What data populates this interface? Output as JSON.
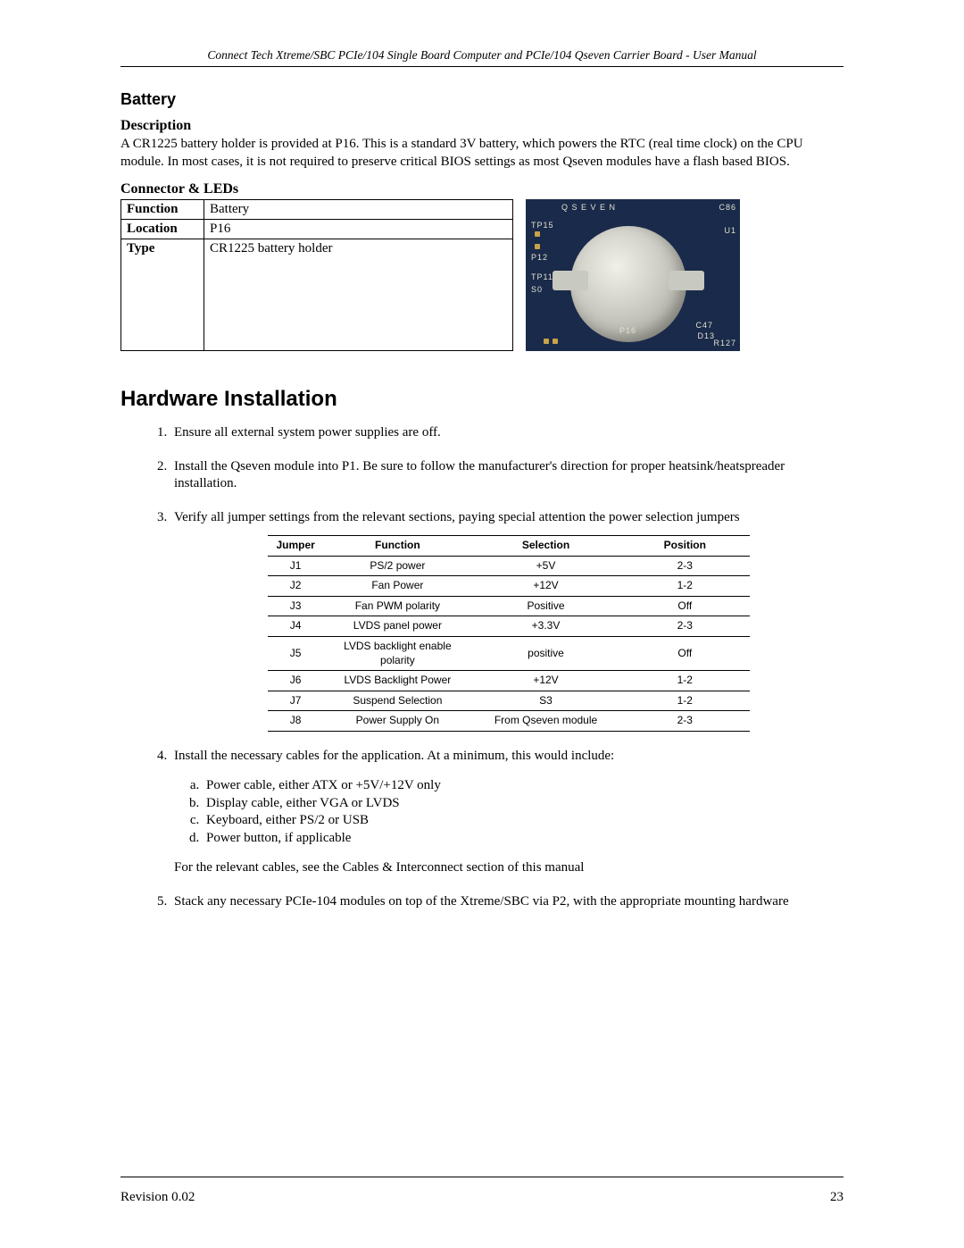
{
  "header": "Connect Tech Xtreme/SBC PCIe/104 Single Board Computer and PCIe/104 Qseven Carrier Board - User Manual",
  "battery": {
    "title": "Battery",
    "desc_heading": "Description",
    "desc_text": "A CR1225 battery holder is provided at P16.  This is a standard 3V battery, which powers the RTC (real time clock) on the CPU module.  In most cases, it is not required to preserve critical BIOS settings as most Qseven modules have a flash based BIOS.",
    "conn_heading": "Connector & LEDs",
    "rows": {
      "function_label": "Function",
      "function_value": "Battery",
      "location_label": "Location",
      "location_value": "P16",
      "type_label": "Type",
      "type_value": "CR1225 battery holder"
    },
    "silk": {
      "brand": "Q S E V E N",
      "ref": "P16",
      "cap": "C47",
      "res": "R127",
      "tp15": "TP15",
      "tp12": "P12",
      "tp11": "TP11",
      "c86": "C86",
      "u1": "U1",
      "d13": "D13",
      "s0": "S0"
    }
  },
  "hw": {
    "title": "Hardware Installation",
    "steps": [
      "Ensure all external system power supplies are off.",
      "Install the Qseven module into P1. Be sure to follow the manufacturer's direction for proper heatsink/heatspreader installation.",
      "Verify all jumper settings from the relevant sections, paying special attention the power selection jumpers",
      "Install the necessary cables for the application.  At a minimum, this would include:",
      "Stack any necessary PCIe-104 modules on top of the Xtreme/SBC via P2, with the appropriate mounting hardware"
    ],
    "jumper_headers": {
      "c1": "Jumper",
      "c2": "Function",
      "c3": "Selection",
      "c4": "Position"
    },
    "jumpers": [
      {
        "j": "J1",
        "f": "PS/2 power",
        "s": "+5V",
        "p": "2-3"
      },
      {
        "j": "J2",
        "f": "Fan Power",
        "s": "+12V",
        "p": "1-2"
      },
      {
        "j": "J3",
        "f": "Fan PWM polarity",
        "s": "Positive",
        "p": "Off"
      },
      {
        "j": "J4",
        "f": "LVDS panel power",
        "s": "+3.3V",
        "p": "2-3"
      },
      {
        "j": "J5",
        "f": "LVDS backlight enable polarity",
        "s": "positive",
        "p": "Off"
      },
      {
        "j": "J6",
        "f": "LVDS Backlight Power",
        "s": "+12V",
        "p": "1-2"
      },
      {
        "j": "J7",
        "f": "Suspend Selection",
        "s": "S3",
        "p": "1-2"
      },
      {
        "j": "J8",
        "f": "Power Supply On",
        "s": "From Qseven module",
        "p": "2-3"
      }
    ],
    "cables": [
      "Power cable, either ATX or +5V/+12V only",
      "Display cable, either VGA or LVDS",
      "Keyboard, either PS/2 or USB",
      "Power button, if applicable"
    ],
    "cables_followup": "For the relevant cables, see the Cables & Interconnect section of this manual"
  },
  "footer": {
    "revision": "Revision 0.02",
    "page": "23"
  }
}
